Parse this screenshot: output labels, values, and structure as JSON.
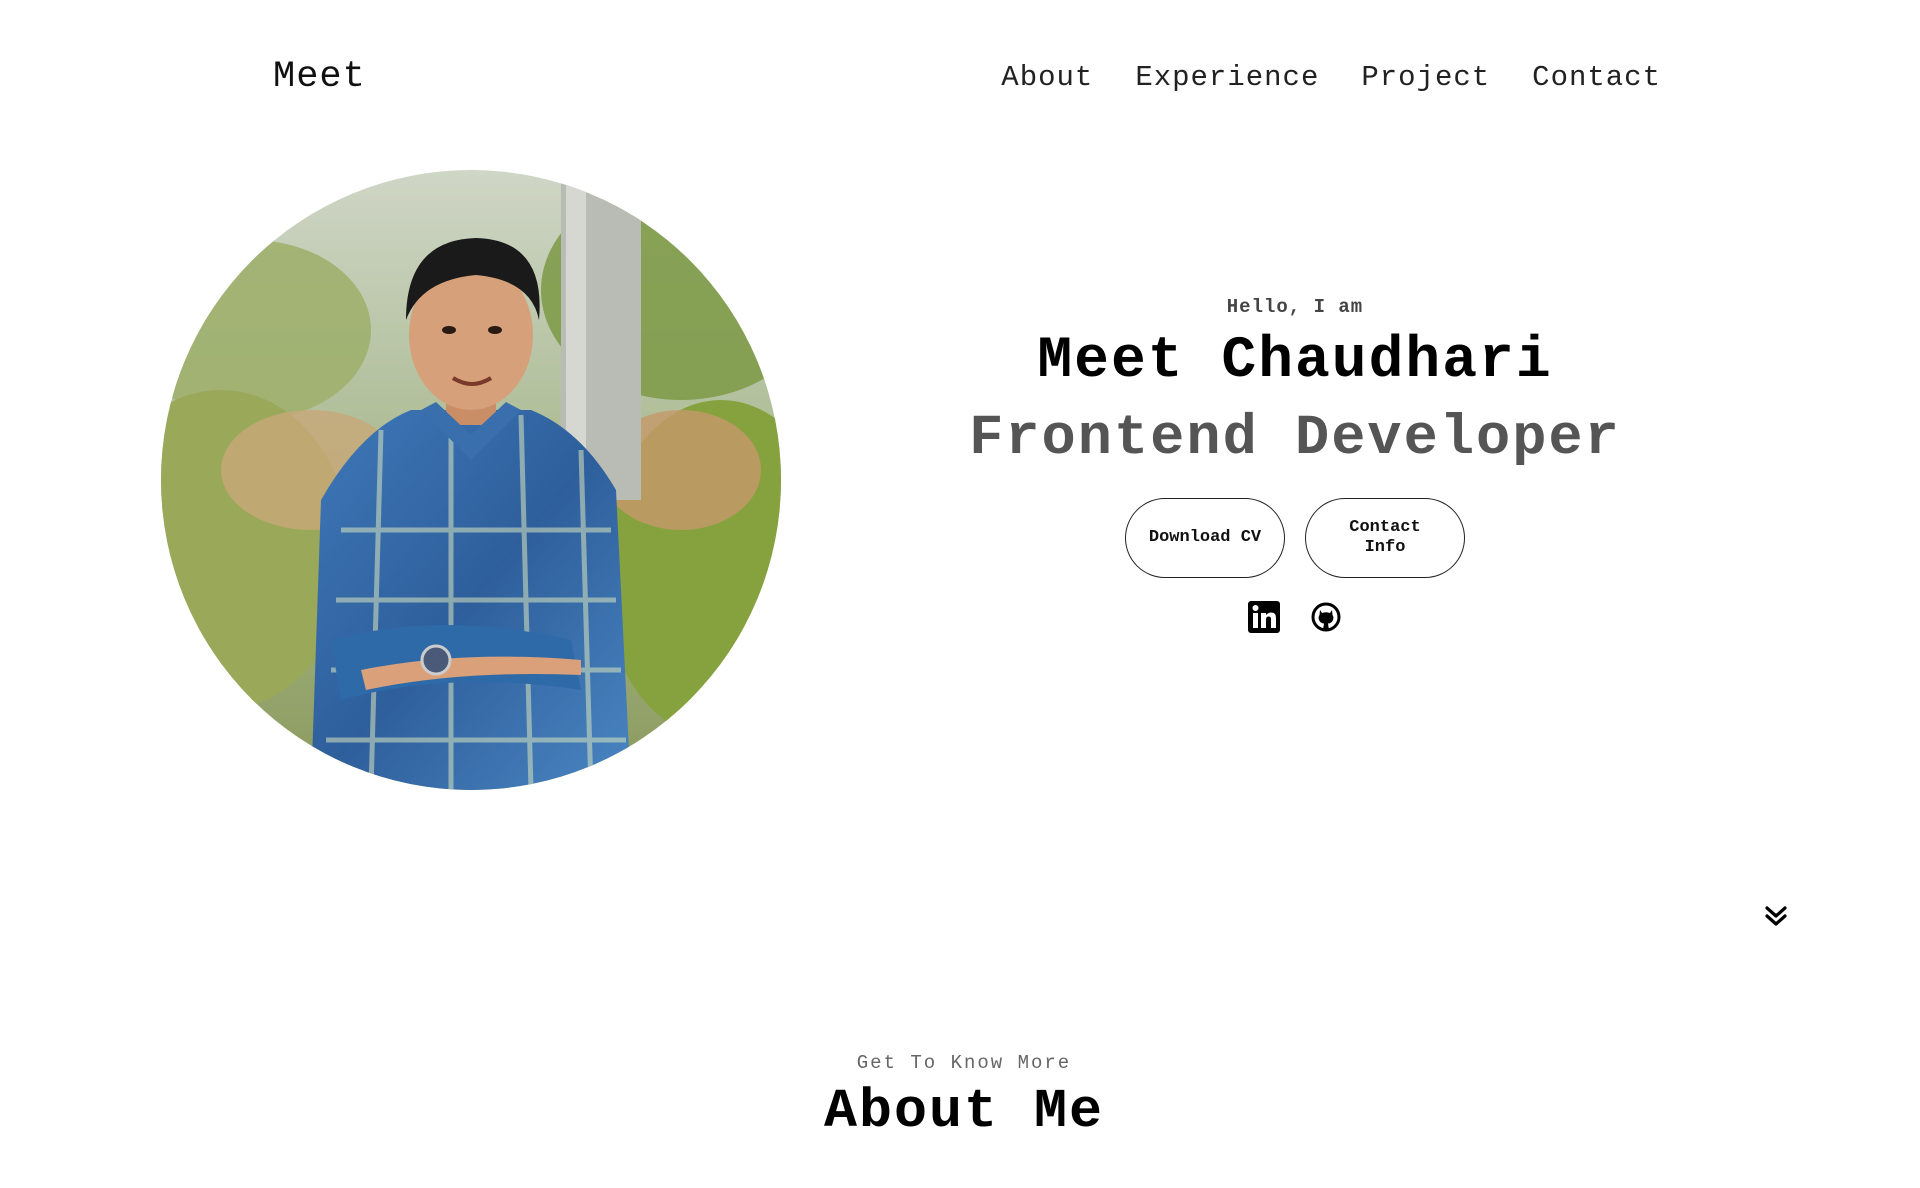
{
  "nav": {
    "logo": "Meet",
    "links": [
      "About",
      "Experience",
      "Project",
      "Contact"
    ]
  },
  "hero": {
    "greeting": "Hello, I am",
    "name": "Meet Chaudhari",
    "role": "Frontend Developer",
    "buttons": {
      "download_cv": "Download CV",
      "contact_info": "Contact Info"
    },
    "socials": [
      "linkedin-icon",
      "github-icon"
    ],
    "scroll_icon": "double-chevron-down-icon"
  },
  "about": {
    "subtitle": "Get To Know More",
    "title": "About Me"
  },
  "colors": {
    "text_primary": "#000000",
    "text_secondary": "#555555",
    "background": "#ffffff"
  }
}
